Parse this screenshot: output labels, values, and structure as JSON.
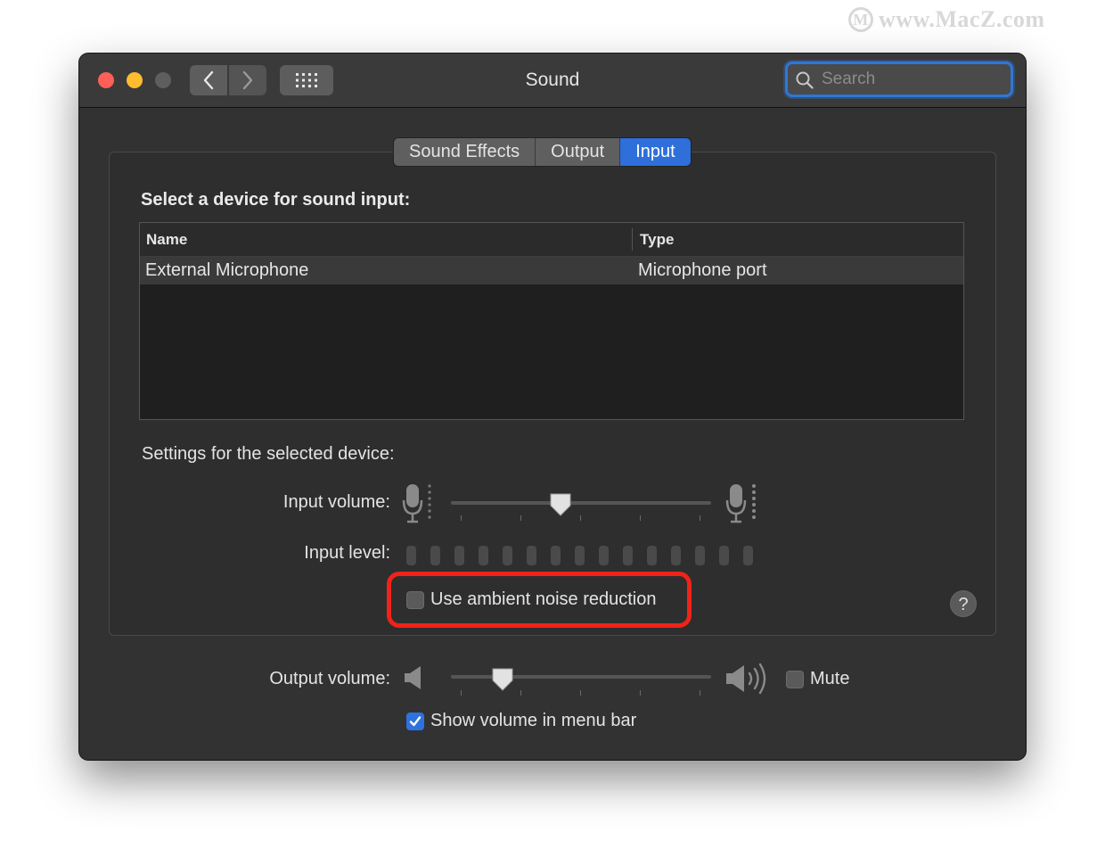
{
  "watermark": {
    "logo": "M",
    "text": "www.MacZ.com"
  },
  "window": {
    "title": "Sound",
    "search": {
      "placeholder": "Search"
    }
  },
  "tabs": [
    {
      "label": "Sound Effects",
      "selected": false
    },
    {
      "label": "Output",
      "selected": false
    },
    {
      "label": "Input",
      "selected": true
    }
  ],
  "input_panel": {
    "heading": "Select a device for sound input:",
    "table": {
      "columns": [
        "Name",
        "Type"
      ],
      "rows": [
        {
          "name": "External Microphone",
          "type": "Microphone port",
          "selected": true
        }
      ]
    },
    "settings_heading": "Settings for the selected device:",
    "input_volume_label": "Input volume:",
    "input_volume_level": 0.42,
    "input_level_label": "Input level:",
    "input_level_segments": 15,
    "input_level_lit": 0,
    "ambient_noise_label": "Use ambient noise reduction",
    "ambient_noise_checked": false,
    "help_label": "?"
  },
  "output": {
    "output_volume_label": "Output volume:",
    "output_volume_level": 0.2,
    "mute_label": "Mute",
    "mute_checked": false,
    "show_volume_label": "Show volume in menu bar",
    "show_volume_checked": true
  },
  "colors": {
    "accent": "#2e6fd9",
    "highlight_box": "#f0231a",
    "window_bg": "#323232"
  },
  "icons": [
    "back-chevron-icon",
    "forward-chevron-icon",
    "grid-icon",
    "search-icon",
    "microphone-icon",
    "speaker-low-icon",
    "speaker-high-icon",
    "checkmark-icon"
  ]
}
